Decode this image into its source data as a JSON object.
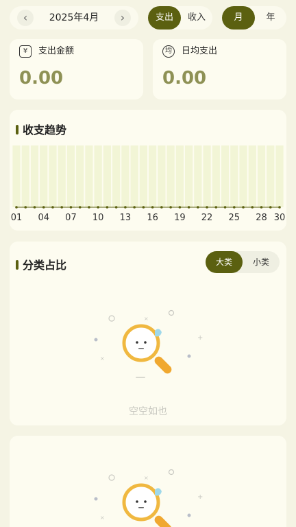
{
  "header": {
    "month_label": "2025年4月",
    "prev_icon": "chevron-left-icon",
    "next_icon": "chevron-right-icon",
    "type_toggle": [
      "支出",
      "收入"
    ],
    "type_selected": "支出",
    "period_toggle": [
      "月",
      "年"
    ],
    "period_selected": "月"
  },
  "stats": {
    "total": {
      "icon": "money-icon",
      "label": "支出金额",
      "value": "0.00"
    },
    "daily": {
      "icon": "average-icon",
      "label": "日均支出",
      "value": "0.00"
    }
  },
  "trend": {
    "title": "收支趋势"
  },
  "chart_data": {
    "type": "bar",
    "x": [
      "01",
      "02",
      "03",
      "04",
      "05",
      "06",
      "07",
      "08",
      "09",
      "10",
      "11",
      "12",
      "13",
      "14",
      "15",
      "16",
      "17",
      "18",
      "19",
      "20",
      "21",
      "22",
      "23",
      "24",
      "25",
      "26",
      "27",
      "28",
      "29",
      "30"
    ],
    "tick_labels": [
      "01",
      "04",
      "07",
      "10",
      "13",
      "16",
      "19",
      "22",
      "25",
      "28",
      "30"
    ],
    "values": [
      0,
      0,
      0,
      0,
      0,
      0,
      0,
      0,
      0,
      0,
      0,
      0,
      0,
      0,
      0,
      0,
      0,
      0,
      0,
      0,
      0,
      0,
      0,
      0,
      0,
      0,
      0,
      0,
      0,
      0
    ],
    "title": "",
    "xlabel": "",
    "ylabel": "",
    "grid": false
  },
  "category": {
    "title": "分类占比",
    "tabs": [
      "大类",
      "小类"
    ],
    "tab_selected": "大类",
    "empty_text": "空空如也",
    "empty_icon": "magnifier-face-icon"
  },
  "colors": {
    "accent": "#5b6010",
    "value_text": "#8e9155",
    "background": "#f5f4e4",
    "card": "#fdfcf0",
    "bar": "#f2f5d6",
    "magnifier": "#f0a830"
  }
}
